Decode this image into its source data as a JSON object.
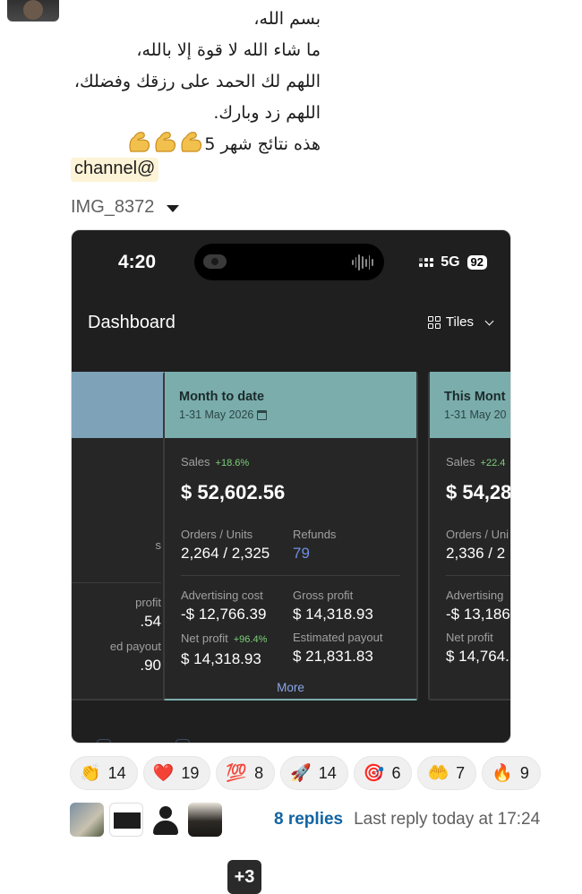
{
  "message": {
    "lines": [
      "بسم الله،",
      "ما شاء الله لا قوة إلا بالله،",
      "اللهم لك الحمد على رزقك وفضلك،",
      "اللهم زد وبارك.",
      "هذه نتائج شهر 5"
    ],
    "emoji": "flexed-biceps-emoji",
    "mention": "channel@"
  },
  "attachment": {
    "file_name": "IMG_8372"
  },
  "screenshot": {
    "status": {
      "time": "4:20",
      "network": "5G",
      "battery": "92"
    },
    "header": {
      "title": "Dashboard",
      "view": "Tiles"
    },
    "cards": [
      {
        "title": "",
        "date": "",
        "net_profit_label": "profit",
        "net_profit": ".54",
        "payout_label": "ed payout",
        "payout": ".90",
        "orders_suffix": "s"
      },
      {
        "title": "Month to date",
        "date": "1-31 May 2026",
        "sales_label": "Sales",
        "sales_change": "+18.6%",
        "sales": "$ 52,602.56",
        "orders_label": "Orders / Units",
        "orders": "2,264 / 2,325",
        "refunds_label": "Refunds",
        "refunds": "79",
        "ad_cost_label": "Advertising cost",
        "ad_cost": "-$ 12,766.39",
        "gross_label": "Gross profit",
        "gross": "$ 14,318.93",
        "net_label": "Net profit",
        "net_change": "+96.4%",
        "net": "$ 14,318.93",
        "payout_label": "Estimated payout",
        "payout": "$ 21,831.83",
        "more": "More"
      },
      {
        "title": "This Mont",
        "date": "1-31 May 20",
        "sales_label": "Sales",
        "sales_change": "+22.4",
        "sales": "$ 54,28",
        "orders_label": "Orders / Uni",
        "orders": "2,336 / 2",
        "ad_cost_label": "Advertising",
        "ad_cost": "-$ 13,186",
        "net_label": "Net profit",
        "net": "$ 14,764."
      }
    ]
  },
  "reactions": [
    {
      "emoji": "👏",
      "name": "clap-emoji",
      "count": "14"
    },
    {
      "emoji": "❤️",
      "name": "heart-emoji",
      "count": "19"
    },
    {
      "emoji": "💯",
      "name": "hundred-points-emoji",
      "count": "8"
    },
    {
      "emoji": "🚀",
      "name": "rocket-emoji",
      "count": "14"
    },
    {
      "emoji": "🎯",
      "name": "direct-hit-emoji",
      "count": "6"
    },
    {
      "emoji": "🤲",
      "name": "palms-up-emoji",
      "count": "7"
    },
    {
      "emoji": "🔥",
      "name": "fire-emoji",
      "count": "9"
    }
  ],
  "thread": {
    "extra_participants": "+3",
    "replies": "8 replies",
    "last_reply": "Last reply today at 17:24"
  }
}
